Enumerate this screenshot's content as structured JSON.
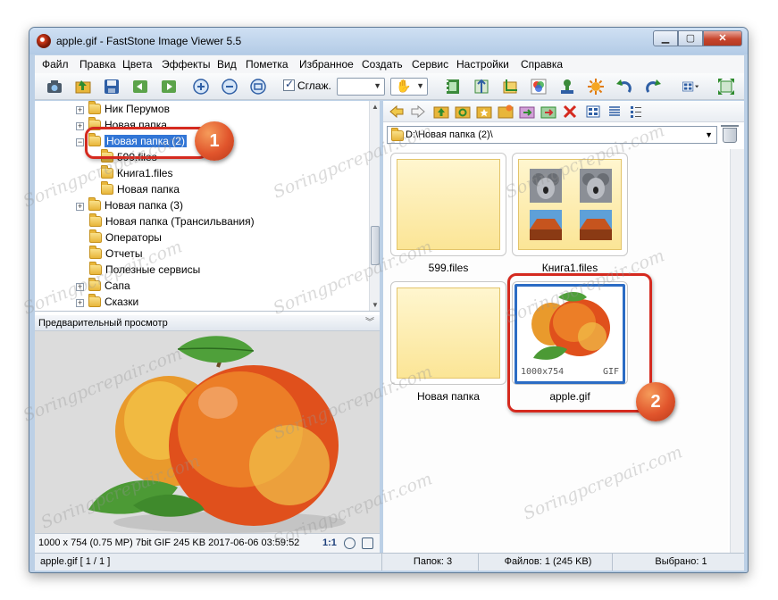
{
  "window": {
    "title": "apple.gif  -  FastStone Image Viewer 5.5"
  },
  "menu": [
    "Файл",
    "Правка",
    "Цвета",
    "Эффекты",
    "Вид",
    "Пометка",
    "Избранное",
    "Создать",
    "Сервис",
    "Настройки",
    "Справка"
  ],
  "toolbar": {
    "smooth_label": "Сглаж.",
    "smooth_checked": true
  },
  "tree": {
    "items": [
      {
        "label": "Ник Перумов",
        "level": 1,
        "expander": "+"
      },
      {
        "label": "Новая папка",
        "level": 1,
        "expander": "+"
      },
      {
        "label": "Новая папка (2)",
        "level": 1,
        "expander": "−",
        "selected": true
      },
      {
        "label": "599.files",
        "level": 2,
        "expander": ""
      },
      {
        "label": "Книга1.files",
        "level": 2,
        "expander": ""
      },
      {
        "label": "Новая папка",
        "level": 2,
        "expander": ""
      },
      {
        "label": "Новая папка (3)",
        "level": 1,
        "expander": "+"
      },
      {
        "label": "Новая папка (Трансильвания)",
        "level": 1,
        "expander": ""
      },
      {
        "label": "Операторы",
        "level": 1,
        "expander": ""
      },
      {
        "label": "Отчеты",
        "level": 1,
        "expander": ""
      },
      {
        "label": "Полезные сервисы",
        "level": 1,
        "expander": ""
      },
      {
        "label": "Сапа",
        "level": 1,
        "expander": "+"
      },
      {
        "label": "Сказки",
        "level": 1,
        "expander": "+"
      }
    ]
  },
  "preview": {
    "header": "Предварительный просмотр",
    "info": "1000 x 754 (0.75 MP)  7bit  GIF   245 KB   2017-06-06 03:59:52",
    "ratio": "1:1"
  },
  "browser": {
    "path": "D:\\Новая папка (2)\\",
    "thumbnails": [
      {
        "label": "599.files",
        "type": "folder"
      },
      {
        "label": "Книга1.files",
        "type": "folder-images"
      },
      {
        "label": "Новая папка",
        "type": "folder"
      },
      {
        "label": "apple.gif",
        "type": "image",
        "dimensions": "1000x754",
        "format": "GIF",
        "selected": true
      }
    ]
  },
  "status": {
    "file": "apple.gif [ 1 / 1 ]",
    "folders": "Папок: 3",
    "files": "Файлов: 1 (245 KB)",
    "selected": "Выбрано: 1"
  },
  "annotations": {
    "badge1": "1",
    "badge2": "2"
  },
  "watermark": "Soringpcrepair.com",
  "colors": {
    "selection": "#3276d6",
    "callout": "#d52a1f",
    "badge": "#e1552c",
    "thumb_selected": "#2b6cc4"
  }
}
